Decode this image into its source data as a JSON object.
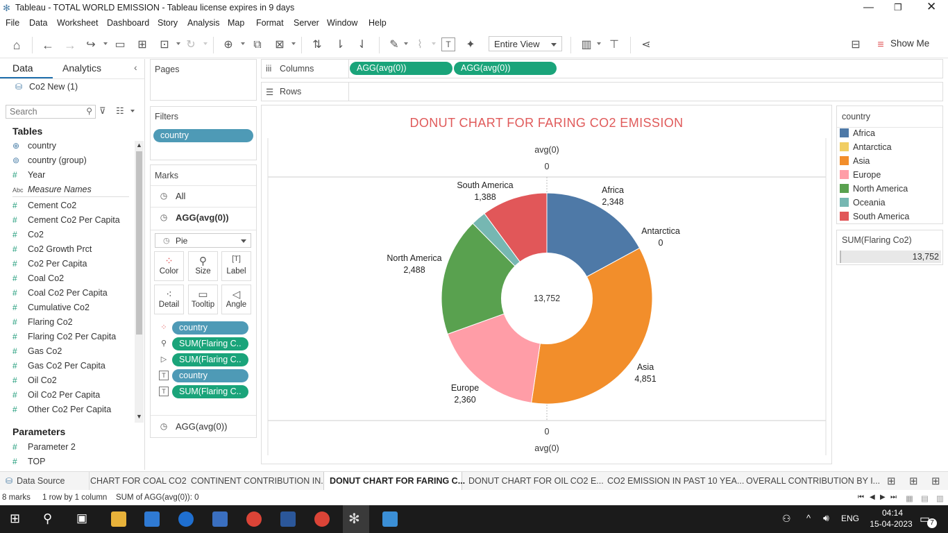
{
  "window": {
    "title": "Tableau - TOTAL WORLD EMISSION - Tableau license expires in 9 days"
  },
  "menu": [
    "File",
    "Data",
    "Worksheet",
    "Dashboard",
    "Story",
    "Analysis",
    "Map",
    "Format",
    "Server",
    "Window",
    "Help"
  ],
  "toolbar": {
    "fit_value": "Entire View",
    "show_me": "Show Me"
  },
  "left": {
    "tab_data": "Data",
    "tab_analytics": "Analytics",
    "datasource": "Co2 New (1)",
    "search_placeholder": "Search",
    "tables_title": "Tables",
    "fields": [
      {
        "icon": "globe",
        "name": "country"
      },
      {
        "icon": "group",
        "name": "country (group)"
      },
      {
        "icon": "#",
        "name": "Year"
      },
      {
        "icon": "Abc",
        "name": "Measure Names"
      },
      {
        "icon": "#",
        "name": "Cement Co2"
      },
      {
        "icon": "#",
        "name": "Cement Co2 Per Capita"
      },
      {
        "icon": "#",
        "name": "Co2"
      },
      {
        "icon": "#",
        "name": "Co2 Growth Prct"
      },
      {
        "icon": "#",
        "name": "Co2 Per Capita"
      },
      {
        "icon": "#",
        "name": "Coal Co2"
      },
      {
        "icon": "#",
        "name": "Coal Co2 Per Capita"
      },
      {
        "icon": "#",
        "name": "Cumulative Co2"
      },
      {
        "icon": "#",
        "name": "Flaring Co2"
      },
      {
        "icon": "#",
        "name": "Flaring Co2 Per Capita"
      },
      {
        "icon": "#",
        "name": "Gas Co2"
      },
      {
        "icon": "#",
        "name": "Gas Co2 Per Capita"
      },
      {
        "icon": "#",
        "name": "Oil Co2"
      },
      {
        "icon": "#",
        "name": "Oil Co2 Per Capita"
      },
      {
        "icon": "#",
        "name": "Other Co2 Per Capita"
      }
    ],
    "params_title": "Parameters",
    "params": [
      {
        "icon": "#",
        "name": "Parameter 2"
      },
      {
        "icon": "#",
        "name": "TOP"
      }
    ]
  },
  "shelves": {
    "pages": "Pages",
    "filters": "Filters",
    "filter_pill": "country",
    "columns": "Columns",
    "rows": "Rows",
    "col_pills": [
      "AGG(avg(0))",
      "AGG(avg(0))"
    ]
  },
  "marks": {
    "title": "Marks",
    "all": "All",
    "agg1": "AGG(avg(0))",
    "mark_type": "Pie",
    "buttons": [
      "Color",
      "Size",
      "Label",
      "Detail",
      "Tooltip",
      "Angle"
    ],
    "pills": [
      {
        "icon": "color",
        "label": "country",
        "kind": "blue"
      },
      {
        "icon": "size",
        "label": "SUM(Flaring C..",
        "kind": "green"
      },
      {
        "icon": "angle",
        "label": "SUM(Flaring C..",
        "kind": "green"
      },
      {
        "icon": "label",
        "label": "country",
        "kind": "blue"
      },
      {
        "icon": "label",
        "label": "SUM(Flaring C..",
        "kind": "green"
      }
    ],
    "agg2": "AGG(avg(0))"
  },
  "viz": {
    "title": "DONUT CHART FOR FARING CO2 EMISSION",
    "top_axis_title": "avg(0)",
    "top_axis_tick": "0",
    "bottom_axis_tick": "0",
    "bottom_axis_title": "avg(0)",
    "center_total": "13,752"
  },
  "chart_data": {
    "type": "pie",
    "title": "DONUT CHART FOR FARING CO2 EMISSION",
    "categories": [
      "Africa",
      "Antarctica",
      "Asia",
      "Europe",
      "North America",
      "Oceania",
      "South America"
    ],
    "values": [
      2348,
      0,
      4851,
      2360,
      2488,
      317,
      1388
    ],
    "value_labels": [
      "2,348",
      "0",
      "4,851",
      "2,360",
      "2,488",
      "",
      "1,388"
    ],
    "colors": [
      "#4e79a7",
      "#f1ce63",
      "#f28e2b",
      "#ff9da7",
      "#59a14f",
      "#76b7b2",
      "#e15759"
    ],
    "total": 13752,
    "donut": true,
    "legend_position": "right"
  },
  "legend": {
    "title": "country",
    "items": [
      {
        "label": "Africa",
        "color": "#4e79a7"
      },
      {
        "label": "Antarctica",
        "color": "#f1ce63"
      },
      {
        "label": "Asia",
        "color": "#f28e2b"
      },
      {
        "label": "Europe",
        "color": "#ff9da7"
      },
      {
        "label": "North America",
        "color": "#59a14f"
      },
      {
        "label": "Oceania",
        "color": "#76b7b2"
      },
      {
        "label": "South America",
        "color": "#e15759"
      }
    ],
    "sum_title": "SUM(Flaring Co2)",
    "sum_value": "13,752"
  },
  "sheet_tabs": {
    "datasource": "Data Source",
    "tabs": [
      "CHART FOR COAL CO2",
      "CONTINENT CONTRIBUTION IN...",
      "DONUT CHART FOR FARING C...",
      "DONUT CHART FOR OIL CO2 E...",
      "CO2 EMISSION IN PAST 10 YEA...",
      "OVERALL CONTRIBUTION BY I..."
    ],
    "active_index": 2
  },
  "status": {
    "marks": "8 marks",
    "rows": "1 row by 1 column",
    "sum": "SUM of AGG(avg(0)): 0"
  },
  "taskbar": {
    "lang": "ENG",
    "time": "04:14",
    "date": "15-04-2023",
    "notif": "7"
  }
}
